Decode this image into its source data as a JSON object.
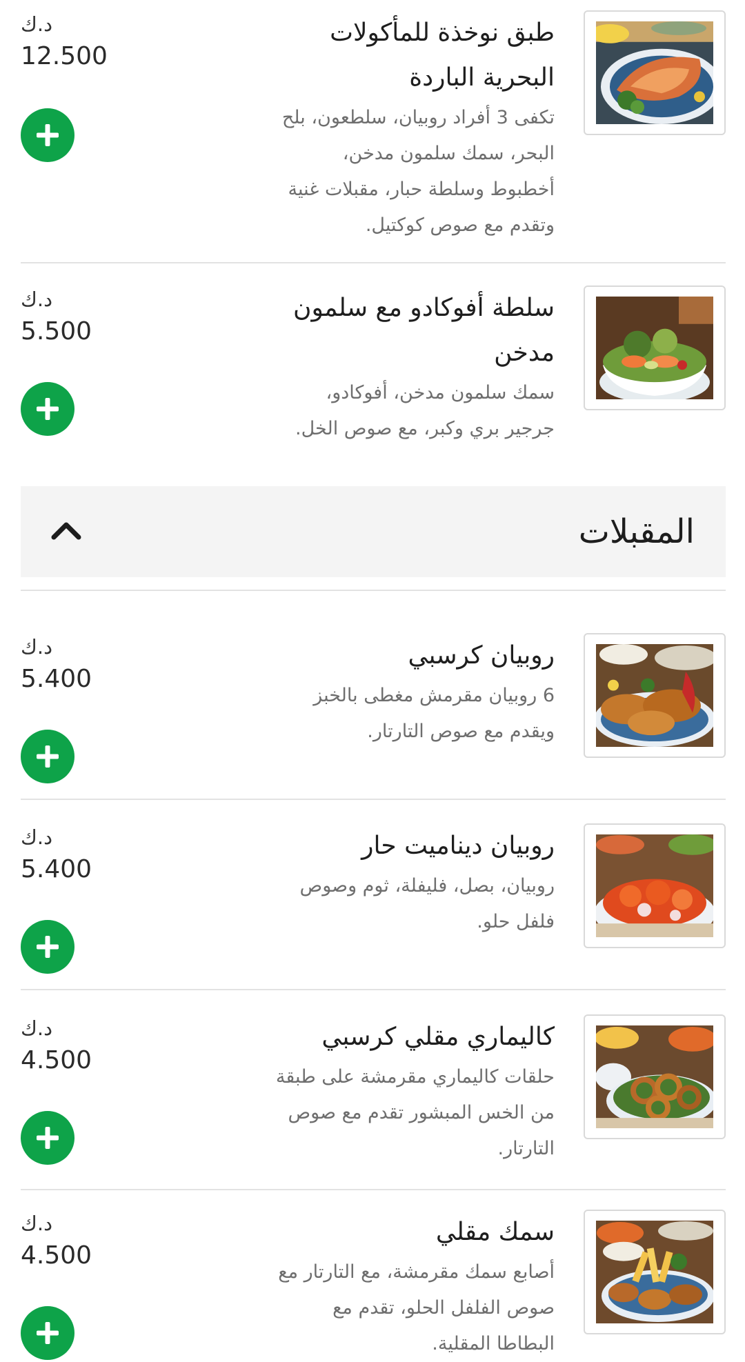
{
  "currency": "د.ك",
  "items_top": [
    {
      "title_lines": [
        "طبق نوخذة للمأكولات",
        "البحرية الباردة"
      ],
      "desc_lines": [
        "تكفى 3 أفراد روبيان، سلطعون، بلح",
        "البحر، سمك سلمون مدخن،",
        "أخطبوط وسلطة حبار، مقبلات غنية",
        "وتقدم مع صوص كوكتيل."
      ],
      "price": "12.500",
      "image": "seafood-platter-photo"
    },
    {
      "title_lines": [
        "سلطة أفوكادو مع سلمون",
        "مدخن"
      ],
      "desc_lines": [
        "سمك سلمون مدخن، أفوكادو،",
        "جرجير بري وكبر، مع صوص الخل."
      ],
      "price": "5.500",
      "image": "salmon-avocado-salad-photo"
    }
  ],
  "section": {
    "title": "المقبلات",
    "collapse_icon": "chevron-up-icon"
  },
  "items_appetizers": [
    {
      "title_lines": [
        "روبيان كرسبي"
      ],
      "desc_lines": [
        "6 روبيان مقرمش مغطى بالخبز",
        "ويقدم مع صوص التارتار."
      ],
      "price": "5.400",
      "image": "crispy-shrimp-photo"
    },
    {
      "title_lines": [
        "روبيان ديناميت حار"
      ],
      "desc_lines": [
        "روبيان، بصل، فليفلة، ثوم وصوص",
        "فلفل حلو."
      ],
      "price": "5.400",
      "image": "dynamite-shrimp-photo"
    },
    {
      "title_lines": [
        "كاليماري مقلي كرسبي"
      ],
      "desc_lines": [
        "حلقات كاليماري مقرمشة على طبقة",
        "من الخس المبشور تقدم مع صوص",
        "التارتار."
      ],
      "price": "4.500",
      "image": "fried-calamari-photo"
    },
    {
      "title_lines": [
        "سمك مقلي"
      ],
      "desc_lines": [
        "أصابع سمك مقرمشة، مع التارتار مع",
        "صوص الفلفل الحلو، تقدم مع",
        "البطاطا المقلية."
      ],
      "price": "4.500",
      "image": "fried-fish-photo"
    }
  ],
  "colors": {
    "add_button": "#0ea349",
    "section_bg": "#f4f4f4",
    "divider": "#e2e2e2"
  }
}
